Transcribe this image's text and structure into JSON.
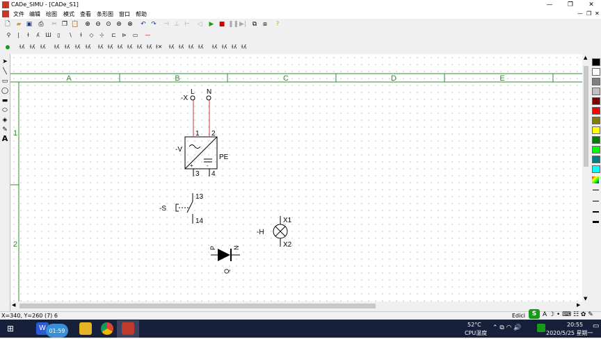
{
  "window": {
    "title": "CADe_SIMU - [CADe_S1]",
    "controls": {
      "minimize": "—",
      "maximize": "❐",
      "close": "✕"
    },
    "child_controls": {
      "minimize": "—",
      "restore": "❐",
      "close": "✕"
    }
  },
  "menu": [
    "文件",
    "编辑",
    "绘图",
    "模式",
    "查看",
    "条形图",
    "窗口",
    "帮助"
  ],
  "canvas": {
    "columns": [
      "A",
      "B",
      "C",
      "D",
      "E"
    ],
    "rows": [
      "1",
      "2"
    ],
    "grid_color": "#2e8b2e",
    "components": {
      "power_supply": {
        "terminal_x": "-X",
        "L": "L",
        "N": "N",
        "ref": "-V",
        "pin1": "1",
        "pin2": "2",
        "pin3": "3",
        "pin4": "4",
        "pe": "PE",
        "plus": "+",
        "minus": "-"
      },
      "switch": {
        "ref": "-S",
        "pin_top": "13",
        "pin_bottom": "14"
      },
      "lamp": {
        "ref": "-H",
        "pin_top": "X1",
        "pin_bottom": "X2"
      },
      "diode": {
        "p": "P",
        "n": "N",
        "q": "Q"
      }
    }
  },
  "status": {
    "coordinates": "X=340, Y=260 (7) 6",
    "mode": "Edici"
  },
  "taskbar": {
    "clock_badge": "01:59",
    "temperature": "52°C",
    "temperature_label": "CPU温度",
    "time": "20:55",
    "date": "2020/5/25 星期一"
  },
  "palette_colors": [
    "#000000",
    "#ffffff",
    "#808080",
    "#c0c0c0",
    "#800000",
    "#ff0000",
    "#808000",
    "#ffff00",
    "#008000",
    "#00ff00",
    "#008080",
    "#00ffff"
  ]
}
